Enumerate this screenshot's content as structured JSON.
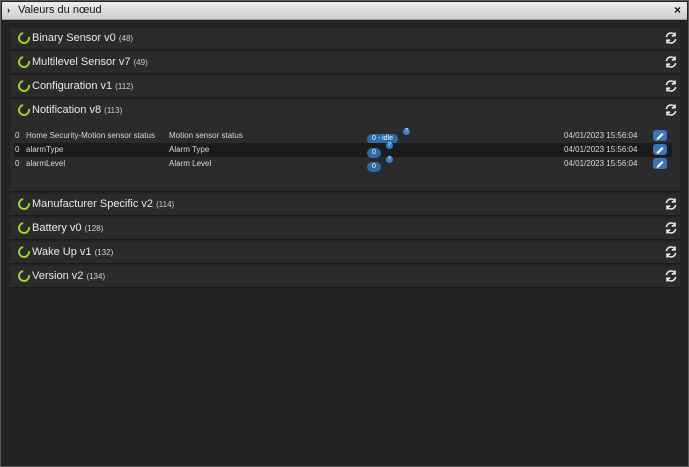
{
  "window": {
    "title": "Valeurs du nœud",
    "close_glyph": "×",
    "collapse_glyph": "›"
  },
  "panels": [
    {
      "name": "Binary Sensor v0",
      "id": "(48)"
    },
    {
      "name": "Multilevel Sensor v7",
      "id": "(49)"
    },
    {
      "name": "Configuration v1",
      "id": "(112)"
    },
    {
      "name": "Notification v8",
      "id": "(113)"
    },
    {
      "name": "Manufacturer Specific v2",
      "id": "(114)"
    },
    {
      "name": "Battery v0",
      "id": "(128)"
    },
    {
      "name": "Wake Up v1",
      "id": "(132)"
    },
    {
      "name": "Version v2",
      "id": "(134)"
    }
  ],
  "notification_rows": [
    {
      "instance": "0",
      "label": "Home Security-Motion sensor status",
      "help": "Motion sensor status",
      "value": "0 - idle",
      "date": "04/01/2023 15:56:04"
    },
    {
      "instance": "0",
      "label": "alarmType",
      "help": "Alarm Type",
      "value": "0",
      "date": "04/01/2023 15:56:04"
    },
    {
      "instance": "0",
      "label": "alarmLevel",
      "help": "Alarm Level",
      "value": "0",
      "date": "04/01/2023 15:56:04"
    }
  ],
  "help_glyph": "?",
  "colors": {
    "accent_green": "#9fd12e",
    "badge_blue": "#2f6aa8",
    "titlebar": "#e0e0e0"
  },
  "icons": {
    "panel_status": "ring-spinner-icon",
    "refresh": "refresh-icon",
    "edit": "pencil-icon"
  }
}
